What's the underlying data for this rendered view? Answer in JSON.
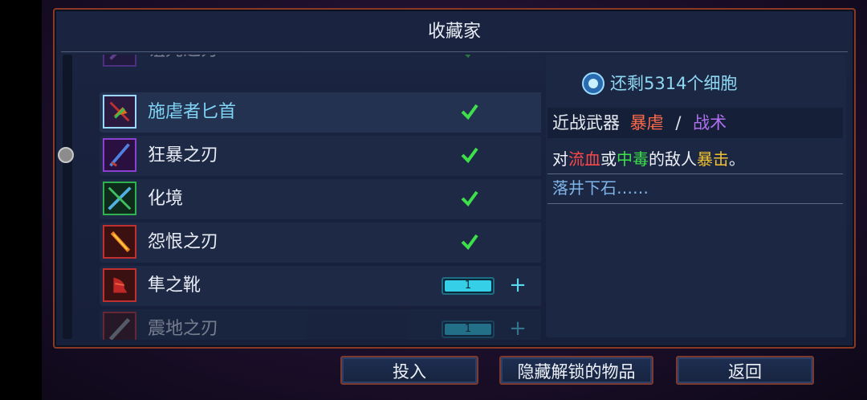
{
  "title": "收藏家",
  "cells_text": "还剩5314个细胞",
  "items": [
    {
      "label": "诅咒之刃",
      "status": "check",
      "partial": true
    },
    {
      "label": "施虐者匕首",
      "status": "check",
      "selected": true
    },
    {
      "label": "狂暴之刃",
      "status": "check"
    },
    {
      "label": "化境",
      "status": "check"
    },
    {
      "label": "怨恨之刃",
      "status": "check"
    },
    {
      "label": "隼之靴",
      "status": "stepper",
      "count": "1"
    },
    {
      "label": "震地之刃",
      "status": "stepper",
      "count": "1",
      "partial": true
    }
  ],
  "detail": {
    "category": "近战武器",
    "tag1": "暴虐",
    "separator": "/",
    "tag2": "战术",
    "desc_parts": [
      "对",
      "流血",
      "或",
      "中毒",
      "的敌人",
      "暴击",
      "。"
    ],
    "flavor": "落井下石……"
  },
  "buttons": {
    "invest": "投入",
    "hide_unlocked": "隐藏解锁的物品",
    "back": "返回"
  },
  "colors": {
    "accent_cyan": "#7fd4f4",
    "check_green": "#3ee04a",
    "tag_red": "#ff6a4a",
    "tag_purple": "#b070f0"
  }
}
